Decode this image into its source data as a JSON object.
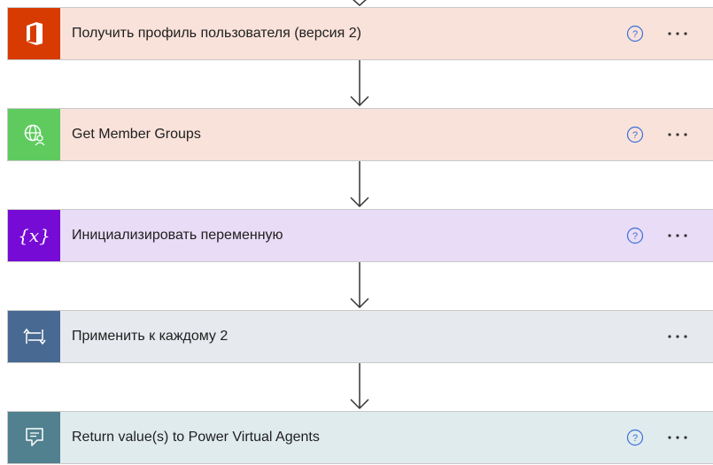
{
  "steps": [
    {
      "label": "Получить профиль пользователя (версия 2)",
      "icon": "office-icon",
      "icon_bg": "#d83b01",
      "card_bg": "#f9e2da",
      "has_help": true
    },
    {
      "label": "Get Member Groups",
      "icon": "globe-user-icon",
      "icon_bg": "#5fcb5f",
      "card_bg": "#f9e2da",
      "has_help": true
    },
    {
      "label": "Инициализировать переменную",
      "icon_text": "{x}",
      "icon": "variable-icon",
      "icon_bg": "#770bd6",
      "card_bg": "#e9dcf6",
      "has_help": true
    },
    {
      "label": "Применить к каждому 2",
      "icon": "loop-icon",
      "icon_bg": "#486991",
      "card_bg": "#e6e9ee",
      "has_help": false
    },
    {
      "label": "Return value(s) to Power Virtual Agents",
      "icon": "chat-bot-icon",
      "icon_bg": "#51808f",
      "card_bg": "#e0ebee",
      "has_help": true
    }
  ],
  "colors": {
    "help": "#3b6fd8",
    "arrow": "#333333",
    "more": "#333333"
  }
}
